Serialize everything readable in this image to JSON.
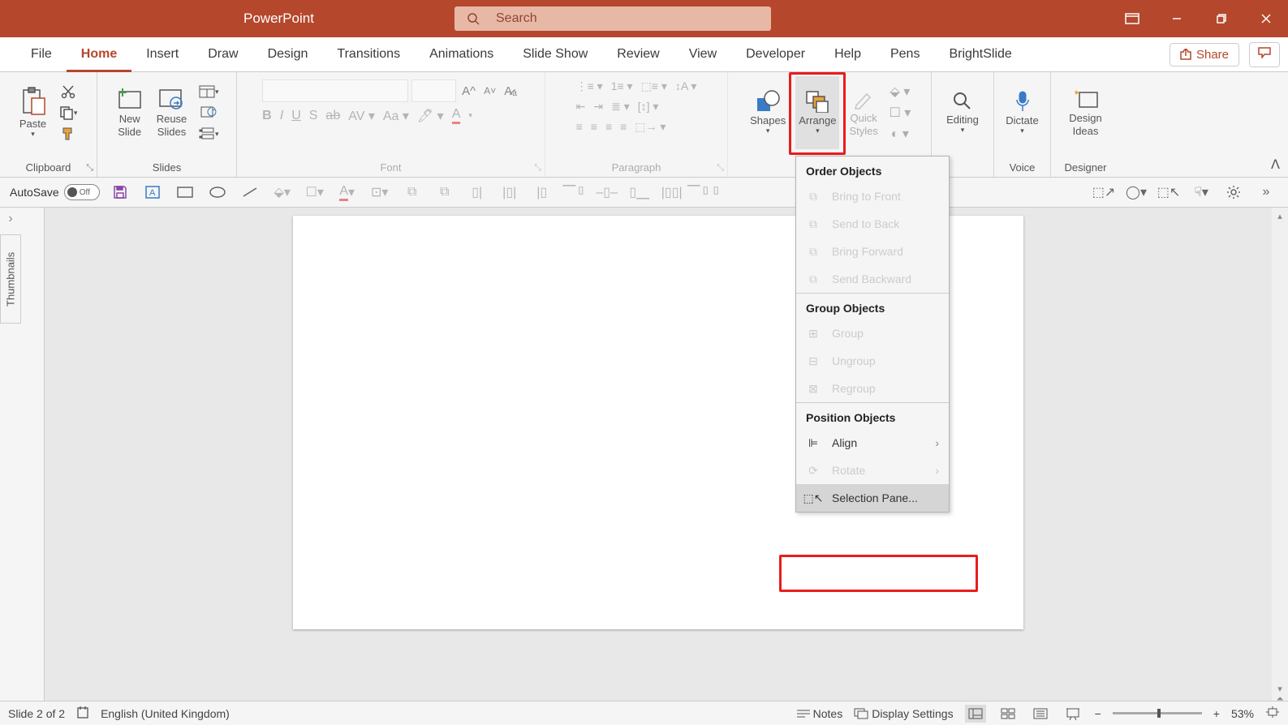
{
  "titlebar": {
    "title": "PowerPoint",
    "search_placeholder": "Search"
  },
  "tabs": {
    "file": "File",
    "home": "Home",
    "insert": "Insert",
    "draw": "Draw",
    "design": "Design",
    "transitions": "Transitions",
    "animations": "Animations",
    "slideshow": "Slide Show",
    "review": "Review",
    "view": "View",
    "developer": "Developer",
    "help": "Help",
    "pens": "Pens",
    "brightslide": "BrightSlide",
    "share": "Share"
  },
  "ribbon": {
    "clipboard": {
      "label": "Clipboard",
      "paste": "Paste"
    },
    "slides": {
      "label": "Slides",
      "new_slide": "New\nSlide",
      "reuse_slides": "Reuse\nSlides"
    },
    "font": {
      "label": "Font"
    },
    "paragraph": {
      "label": "Paragraph"
    },
    "drawing": {
      "shapes": "Shapes",
      "arrange": "Arrange",
      "quick_styles": "Quick\nStyles"
    },
    "editing": {
      "label": "Editing"
    },
    "voice": {
      "label": "Voice",
      "dictate": "Dictate"
    },
    "designer": {
      "label": "Designer",
      "design_ideas": "Design\nIdeas"
    }
  },
  "qat": {
    "autosave": "AutoSave",
    "off": "Off"
  },
  "thumbnails_label": "Thumbnails",
  "dropdown": {
    "order_header": "Order Objects",
    "bring_front": "Bring to Front",
    "send_back": "Send to Back",
    "bring_forward": "Bring Forward",
    "send_backward": "Send Backward",
    "group_header": "Group Objects",
    "group": "Group",
    "ungroup": "Ungroup",
    "regroup": "Regroup",
    "position_header": "Position Objects",
    "align": "Align",
    "rotate": "Rotate",
    "selection_pane": "Selection Pane..."
  },
  "statusbar": {
    "slide_info": "Slide 2 of 2",
    "language": "English (United Kingdom)",
    "notes": "Notes",
    "display_settings": "Display Settings",
    "zoom": "53%"
  }
}
